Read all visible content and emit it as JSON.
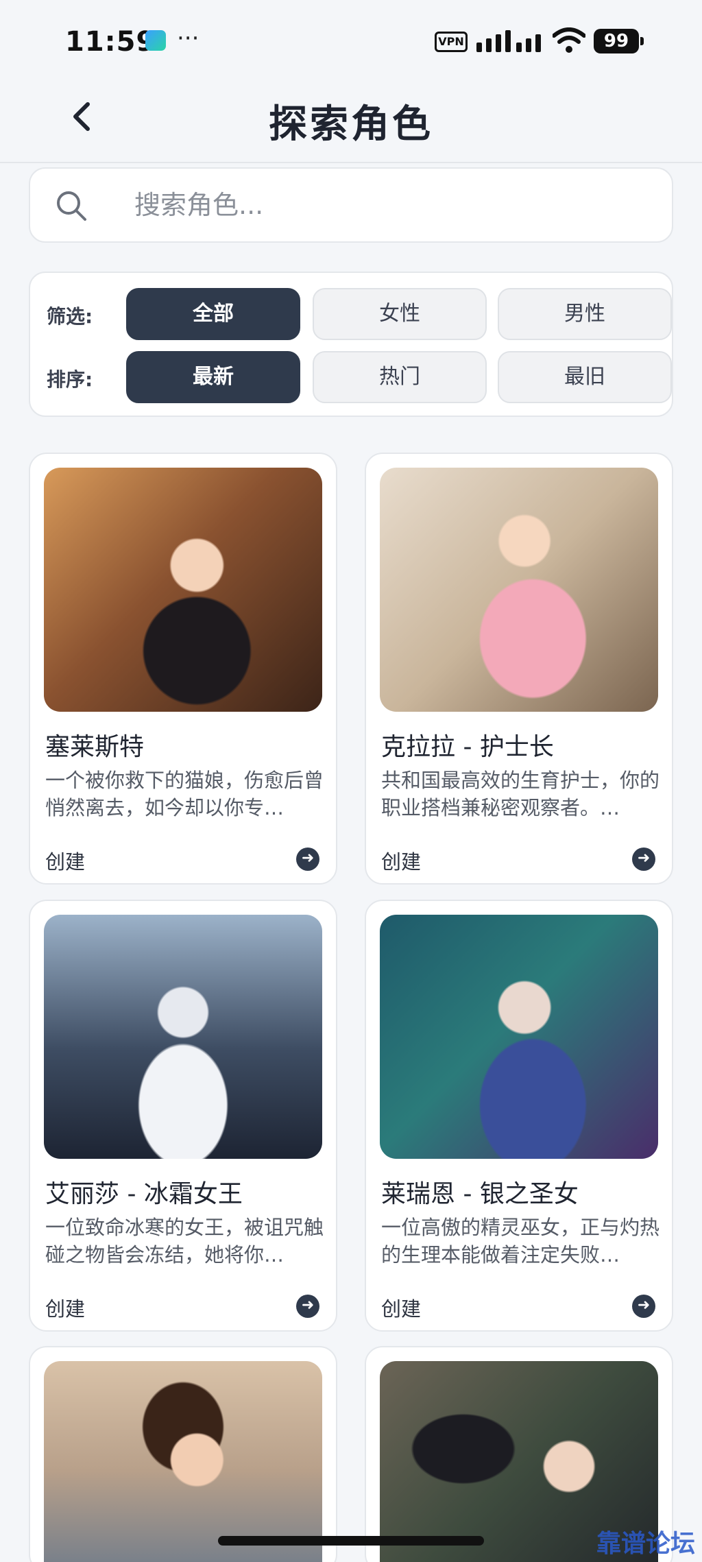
{
  "status": {
    "time": "11:59",
    "dots": "···",
    "vpn": "VPN",
    "battery": "99"
  },
  "header": {
    "back_icon": "chevron-left-icon",
    "title": "探索角色"
  },
  "search": {
    "placeholder": "搜索角色..."
  },
  "filters": {
    "filter_label": "筛选:",
    "filter_options": [
      "全部",
      "女性",
      "男性"
    ],
    "filter_selected": "全部",
    "sort_label": "排序:",
    "sort_options": [
      "最新",
      "热门",
      "最旧"
    ],
    "sort_selected": "最新"
  },
  "cards": [
    {
      "name": "塞莱斯特",
      "desc": "一个被你救下的猫娘，伤愈后曾悄然离去，如今却以你专…",
      "action": "创建"
    },
    {
      "name": "克拉拉 - 护士长",
      "desc": "共和国最高效的生育护士，你的职业搭档兼秘密观察者。…",
      "action": "创建"
    },
    {
      "name": "艾丽莎 - 冰霜女王",
      "desc": "一位致命冰寒的女王，被诅咒触碰之物皆会冻结，她将你…",
      "action": "创建"
    },
    {
      "name": "莱瑞恩 - 银之圣女",
      "desc": "一位高傲的精灵巫女，正与灼热的生理本能做着注定失败…",
      "action": "创建"
    }
  ],
  "watermark": "靠谱论坛"
}
